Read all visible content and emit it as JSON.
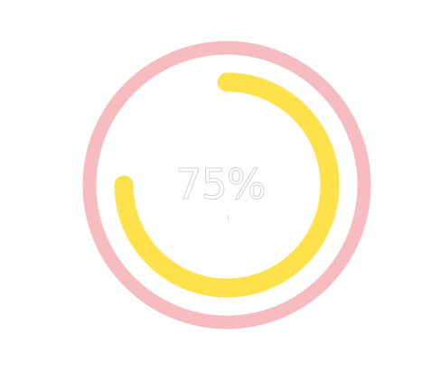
{
  "progress": {
    "value": 0.75,
    "label": "75%"
  },
  "colors": {
    "background": "#ffffff",
    "outer_ring": "#f7bcbf",
    "progress_arc": "#ffe24b",
    "label_outline": "#d4d4d4"
  }
}
